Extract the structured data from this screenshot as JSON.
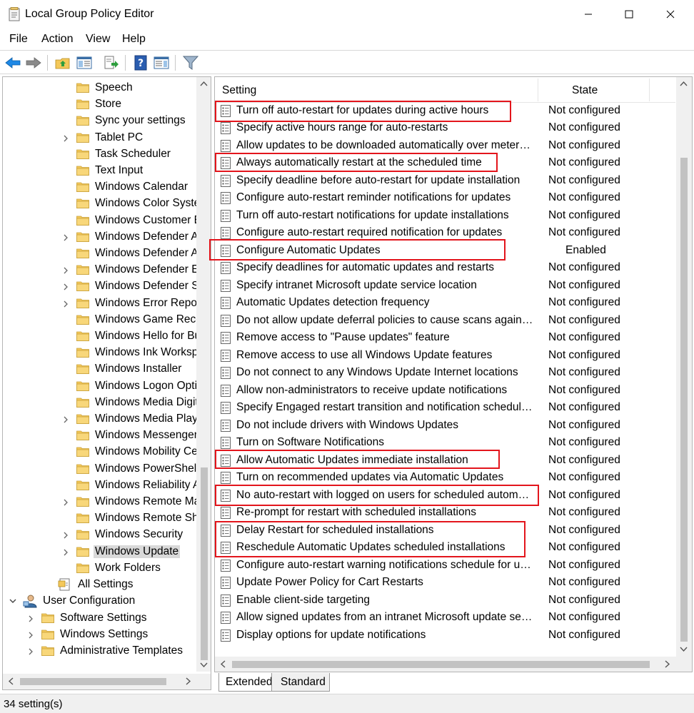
{
  "window": {
    "title": "Local Group Policy Editor",
    "icon": "policy-document-icon"
  },
  "menu": [
    "File",
    "Action",
    "View",
    "Help"
  ],
  "toolbar": [
    "back-arrow-icon",
    "forward-arrow-icon",
    "up-folder-icon",
    "show-hide-tree-icon",
    "export-list-icon",
    "help-icon",
    "properties-pane-icon",
    "filter-icon"
  ],
  "tree": {
    "items": [
      {
        "label": "Speech",
        "expandable": false
      },
      {
        "label": "Store",
        "expandable": false
      },
      {
        "label": "Sync your settings",
        "expandable": false
      },
      {
        "label": "Tablet PC",
        "expandable": true
      },
      {
        "label": "Task Scheduler",
        "expandable": false
      },
      {
        "label": "Text Input",
        "expandable": false
      },
      {
        "label": "Windows Calendar",
        "expandable": false
      },
      {
        "label": "Windows Color Syste",
        "expandable": false
      },
      {
        "label": "Windows Customer E",
        "expandable": false
      },
      {
        "label": "Windows Defender A",
        "expandable": true
      },
      {
        "label": "Windows Defender Ap",
        "expandable": false
      },
      {
        "label": "Windows Defender Ex",
        "expandable": true
      },
      {
        "label": "Windows Defender Sr",
        "expandable": true
      },
      {
        "label": "Windows Error Repor",
        "expandable": true
      },
      {
        "label": "Windows Game Reco",
        "expandable": false
      },
      {
        "label": "Windows Hello for Bu",
        "expandable": false
      },
      {
        "label": "Windows Ink Worksp",
        "expandable": false
      },
      {
        "label": "Windows Installer",
        "expandable": false
      },
      {
        "label": "Windows Logon Opti",
        "expandable": false
      },
      {
        "label": "Windows Media Digit",
        "expandable": false
      },
      {
        "label": "Windows Media Playe",
        "expandable": true
      },
      {
        "label": "Windows Messenger",
        "expandable": false
      },
      {
        "label": "Windows Mobility Ce",
        "expandable": false
      },
      {
        "label": "Windows PowerShell",
        "expandable": false
      },
      {
        "label": "Windows Reliability A",
        "expandable": false
      },
      {
        "label": "Windows Remote Ma",
        "expandable": true
      },
      {
        "label": "Windows Remote She",
        "expandable": false
      },
      {
        "label": "Windows Security",
        "expandable": true
      },
      {
        "label": "Windows Update",
        "expandable": true,
        "selected": true
      },
      {
        "label": "Work Folders",
        "expandable": false
      }
    ],
    "all_settings": "All Settings",
    "user_configuration": "User Configuration",
    "user_children": [
      "Software Settings",
      "Windows Settings",
      "Administrative Templates"
    ]
  },
  "list": {
    "columns": {
      "setting": "Setting",
      "state": "State"
    },
    "rows": [
      {
        "name": "Turn off auto-restart for updates during active hours",
        "state": "Not configured"
      },
      {
        "name": "Specify active hours range for auto-restarts",
        "state": "Not configured"
      },
      {
        "name": "Allow updates to be downloaded automatically over metered connections",
        "state": "Not configured"
      },
      {
        "name": "Always automatically restart at the scheduled time",
        "state": "Not configured"
      },
      {
        "name": "Specify deadline before auto-restart for update installation",
        "state": "Not configured"
      },
      {
        "name": "Configure auto-restart reminder notifications for updates",
        "state": "Not configured"
      },
      {
        "name": "Turn off auto-restart notifications for update installations",
        "state": "Not configured"
      },
      {
        "name": "Configure auto-restart required notification for updates",
        "state": "Not configured"
      },
      {
        "name": "Configure Automatic Updates",
        "state": "Enabled"
      },
      {
        "name": "Specify deadlines for automatic updates and restarts",
        "state": "Not configured"
      },
      {
        "name": "Specify intranet Microsoft update service location",
        "state": "Not configured"
      },
      {
        "name": "Automatic Updates detection frequency",
        "state": "Not configured"
      },
      {
        "name": "Do not allow update deferral policies to cause scans against Windows Update",
        "state": "Not configured"
      },
      {
        "name": "Remove access to \"Pause updates\" feature",
        "state": "Not configured"
      },
      {
        "name": "Remove access to use all Windows Update features",
        "state": "Not configured"
      },
      {
        "name": "Do not connect to any Windows Update Internet locations",
        "state": "Not configured"
      },
      {
        "name": "Allow non-administrators to receive update notifications",
        "state": "Not configured"
      },
      {
        "name": "Specify Engaged restart transition and notification schedule for updates",
        "state": "Not configured"
      },
      {
        "name": "Do not include drivers with Windows Updates",
        "state": "Not configured"
      },
      {
        "name": "Turn on Software Notifications",
        "state": "Not configured"
      },
      {
        "name": "Allow Automatic Updates immediate installation",
        "state": "Not configured"
      },
      {
        "name": "Turn on recommended updates via Automatic Updates",
        "state": "Not configured"
      },
      {
        "name": "No auto-restart with logged on users for scheduled automatic updates installations",
        "state": "Not configured"
      },
      {
        "name": "Re-prompt for restart with scheduled installations",
        "state": "Not configured"
      },
      {
        "name": "Delay Restart for scheduled installations",
        "state": "Not configured"
      },
      {
        "name": "Reschedule Automatic Updates scheduled installations",
        "state": "Not configured"
      },
      {
        "name": "Configure auto-restart warning notifications schedule for updates",
        "state": "Not configured"
      },
      {
        "name": "Update Power Policy for Cart Restarts",
        "state": "Not configured"
      },
      {
        "name": "Enable client-side targeting",
        "state": "Not configured"
      },
      {
        "name": "Allow signed updates from an intranet Microsoft update service location",
        "state": "Not configured"
      },
      {
        "name": "Display options for update notifications",
        "state": "Not configured"
      }
    ]
  },
  "tabs": [
    "Extended",
    "Standard"
  ],
  "status": "34 setting(s)",
  "colors": {
    "highlight": "#e3151c",
    "folder": "#f4c85a",
    "accent": "#1e88e5"
  }
}
